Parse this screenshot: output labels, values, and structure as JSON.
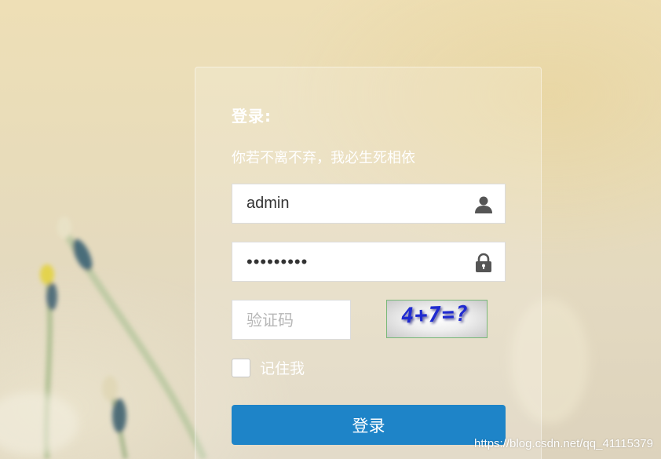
{
  "login": {
    "title": "登录:",
    "slogan": "你若不离不弃，我必生死相依",
    "username_value": "admin",
    "password_value": "123456789",
    "captcha_placeholder": "验证码",
    "captcha_image_text": "4+7=?",
    "remember_label": "记住我",
    "remember_checked": false,
    "submit_label": "登录"
  },
  "icons": {
    "username": "user-icon",
    "password": "lock-icon"
  },
  "watermark": "https://blog.csdn.net/qq_41115379",
  "colors": {
    "button": "#1e84c8",
    "captcha_text": "#1f2ad0"
  }
}
